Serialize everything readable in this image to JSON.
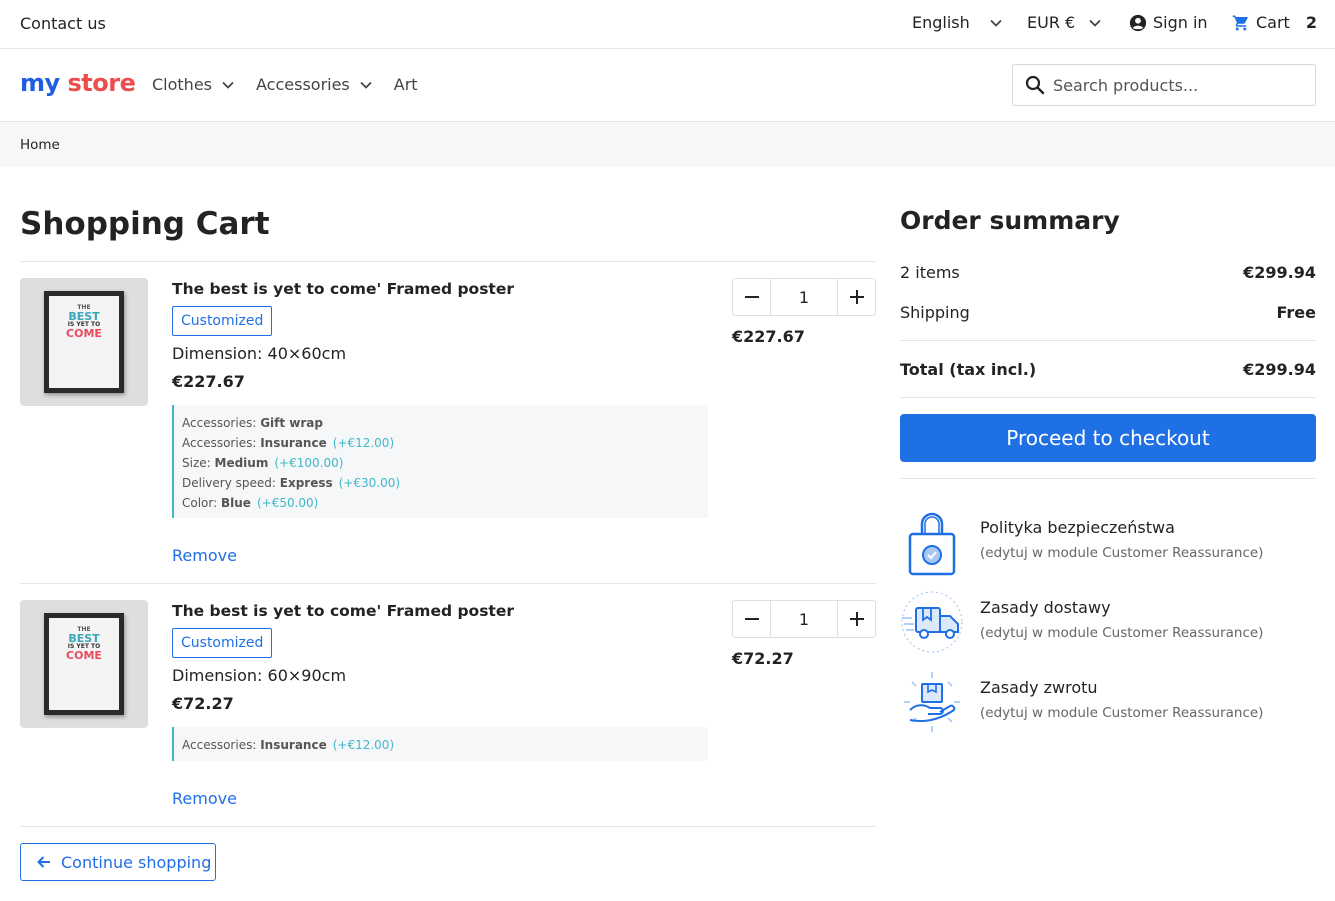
{
  "topbar": {
    "contact": "Contact us",
    "language": "English",
    "currency": "EUR €",
    "sign_in": "Sign in",
    "cart_label": "Cart",
    "cart_count": "2"
  },
  "header": {
    "logo": {
      "part1": "my",
      "part2": "store"
    },
    "nav": [
      {
        "label": "Clothes",
        "has_dropdown": true
      },
      {
        "label": "Accessories",
        "has_dropdown": true
      },
      {
        "label": "Art",
        "has_dropdown": false
      }
    ],
    "search_placeholder": "Search products..."
  },
  "breadcrumb": {
    "home": "Home"
  },
  "cart": {
    "title": "Shopping Cart",
    "items": [
      {
        "name": "The best is yet to come' Framed poster",
        "badge": "Customized",
        "dimension": "Dimension: 40×60cm",
        "unit_price": "€227.67",
        "options": [
          {
            "label": "Accessories:",
            "value": "Gift wrap",
            "extra": ""
          },
          {
            "label": "Accessories:",
            "value": "Insurance",
            "extra": "(+€12.00)"
          },
          {
            "label": "Size:",
            "value": "Medium",
            "extra": "(+€100.00)"
          },
          {
            "label": "Delivery speed:",
            "value": "Express",
            "extra": "(+€30.00)"
          },
          {
            "label": "Color:",
            "value": "Blue",
            "extra": "(+€50.00)"
          }
        ],
        "remove": "Remove",
        "quantity": "1",
        "line_total": "€227.67"
      },
      {
        "name": "The best is yet to come' Framed poster",
        "badge": "Customized",
        "dimension": "Dimension: 60×90cm",
        "unit_price": "€72.27",
        "options": [
          {
            "label": "Accessories:",
            "value": "Insurance",
            "extra": "(+€12.00)"
          }
        ],
        "remove": "Remove",
        "quantity": "1",
        "line_total": "€72.27"
      }
    ],
    "poster_text": {
      "line1": "THE",
      "line2": "BEST",
      "line3": "IS YET TO",
      "line4": "COME"
    },
    "continue": "Continue shopping"
  },
  "summary": {
    "title": "Order summary",
    "items_label": "2 items",
    "items_value": "€299.94",
    "shipping_label": "Shipping",
    "shipping_value": "Free",
    "total_label": "Total (tax incl.)",
    "total_value": "€299.94",
    "checkout": "Proceed to checkout",
    "reassurance": [
      {
        "icon": "lock-icon",
        "title": "Polityka bezpieczeństwa",
        "subtitle": "(edytuj w module Customer Reassurance)"
      },
      {
        "icon": "truck-icon",
        "title": "Zasady dostawy",
        "subtitle": "(edytuj w module Customer Reassurance)"
      },
      {
        "icon": "return-icon",
        "title": "Zasady zwrotu",
        "subtitle": "(edytuj w module Customer Reassurance)"
      }
    ]
  },
  "colors": {
    "accent": "#1f6fe5",
    "option_border": "#3fb8c9",
    "muted_bg": "#f6f7f8"
  }
}
